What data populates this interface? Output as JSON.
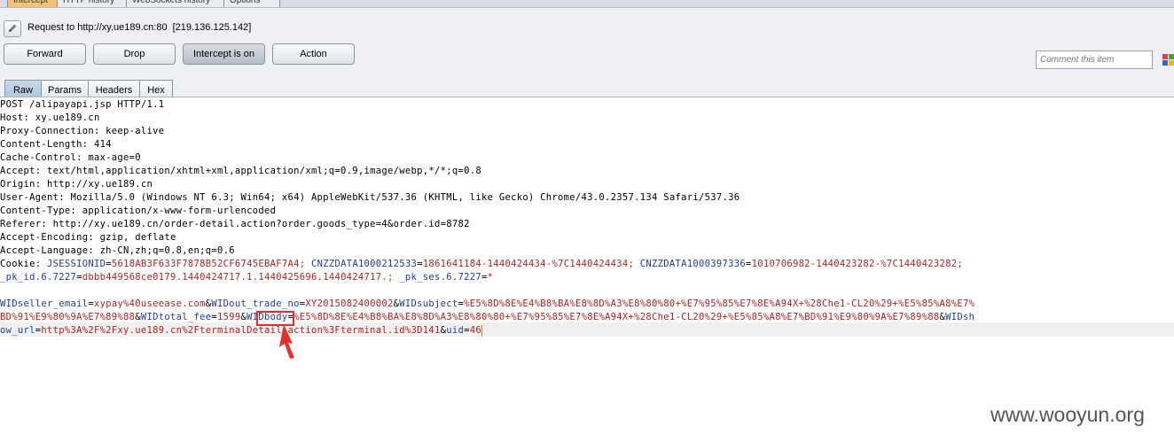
{
  "top_tabs": [
    "Intercept",
    "HTTP history",
    "WebSockets history",
    "Options"
  ],
  "request": {
    "label": "Request to http://xy.ue189.cn:80",
    "ip": "[219.136.125.142]"
  },
  "buttons": {
    "forward": "Forward",
    "drop": "Drop",
    "intercept": "Intercept is on",
    "action": "Action"
  },
  "comment": {
    "placeholder": "Comment this item"
  },
  "sub_tabs": [
    "Raw",
    "Params",
    "Headers",
    "Hex"
  ],
  "raw_lines": [
    "POST /alipayapi.jsp HTTP/1.1",
    "Host: xy.ue189.cn",
    "Proxy-Connection: keep-alive",
    "Content-Length: 414",
    "Cache-Control: max-age=0",
    "Accept: text/html,application/xhtml+xml,application/xml;q=0.9,image/webp,*/*;q=0.8",
    "Origin: http://xy.ue189.cn",
    "User-Agent: Mozilla/5.0 (Windows NT 6.3; Win64; x64) AppleWebKit/537.36 (KHTML, like Gecko) Chrome/43.0.2357.134 Safari/537.36",
    "Content-Type: application/x-www-form-urlencoded",
    "Referer: http://xy.ue189.cn/order-detail.action?order.goods_type=4&order.id=8782",
    "Accept-Encoding: gzip, deflate",
    "Accept-Language: zh-CN,zh;q=0.8,en;q=0.6"
  ],
  "cookie": {
    "label": "Cookie:",
    "k1": "JSESSIONID",
    "v1": "5618AB3F633F7878B52CF6745EBAF7A4;",
    "k2": "CNZZDATA1000212533",
    "v2": "1861641184-1440424434-%7C1440424434;",
    "k3": "CNZZDATA1000397336",
    "v3": "1010706982-1440423282-%7C1440423282;",
    "k4": "_pk_id.6.7227",
    "v4": "dbbb449568ce0179.1440424717.1.1440425696.1440424717.;",
    "k5": "_pk_ses.6.7227",
    "v5": "*"
  },
  "body": {
    "k1": "WIDseller_email",
    "v1": "xypay%40useease.com",
    "k2": "WIDout_trade_no",
    "v2": "XY2015082400002",
    "k3": "WIDsubject",
    "v3": "%E5%8D%8E%E4%B8%BA%E8%8D%A3%E8%80%80+%E7%95%85%E7%8E%A94X+%28Che1-CL20%29+%E5%85%A8%E7%",
    "v3b": "BD%91%E9%80%9A%E7%89%88",
    "k4": "WIDtotal_fee",
    "v4": "1599",
    "k5": "WIDbody",
    "v5": "%E5%8D%8E%E4%B8%BA%E8%8D%A3%E8%80%80+%E7%95%85%E7%8E%A94X+%28Che1-CL20%29+%E5%85%A8%E7%BD%91%E9%80%9A%E7%89%88",
    "k6": "WIDsh",
    "k6b": "ow_url",
    "v6": "http%3A%2F%2Fxy.ue189.cn%2FterminalDetail.action%3Fterminal.id%3D141",
    "k7": "uid",
    "v7": "46"
  },
  "watermark": "www.wooyun.org",
  "colors": {
    "highlight": "#e03030",
    "key": "#1f3aa8",
    "value": "#b22222"
  }
}
